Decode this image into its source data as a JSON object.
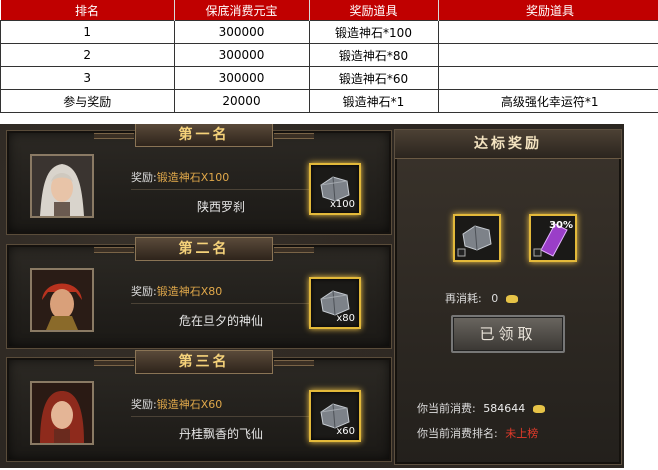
{
  "table": {
    "headers": [
      "排名",
      "保底消费元宝",
      "奖励道具",
      "奖励道具"
    ],
    "rows": [
      [
        "1",
        "300000",
        "锻造神石*100",
        ""
      ],
      [
        "2",
        "300000",
        "锻造神石*80",
        ""
      ],
      [
        "3",
        "300000",
        "锻造神石*60",
        ""
      ],
      [
        "参与奖励",
        "20000",
        "锻造神石*1",
        "高级强化幸运符*1"
      ]
    ]
  },
  "ranks": [
    {
      "title": "第一名",
      "reward_prefix": "奖励:",
      "reward_item": "锻造神石X100",
      "player": "陕西罗刹",
      "qty": "x100"
    },
    {
      "title": "第二名",
      "reward_prefix": "奖励:",
      "reward_item": "锻造神石X80",
      "player": "危在旦夕的神仙",
      "qty": "x80"
    },
    {
      "title": "第三名",
      "reward_prefix": "奖励:",
      "reward_item": "锻造神石X60",
      "player": "丹桂飘香的飞仙",
      "qty": "x60"
    }
  ],
  "standard": {
    "title": "达标奖励",
    "badge": "30%",
    "cost_label": "再消耗:",
    "cost_value": "0",
    "claim_label": "已领取",
    "my_spend_label": "你当前消费:",
    "my_spend_value": "584644",
    "my_rank_label": "你当前消费排名:",
    "my_rank_value": "未上榜"
  }
}
